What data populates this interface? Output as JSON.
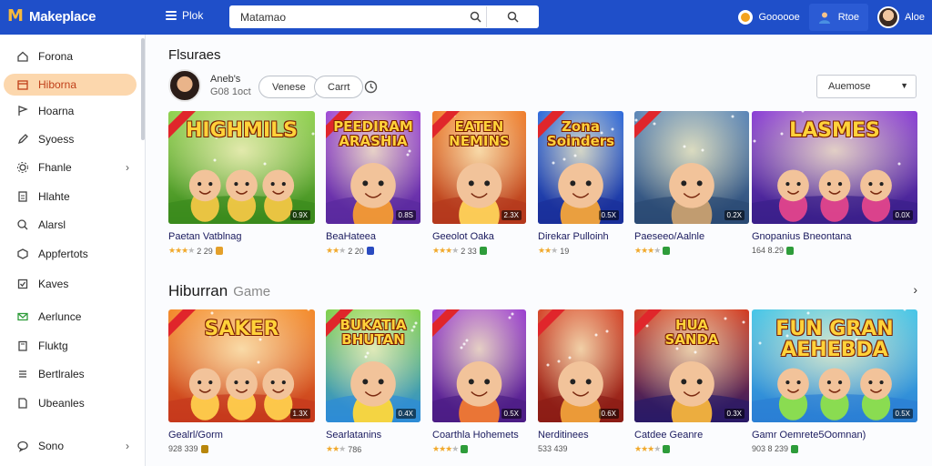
{
  "header": {
    "app_name": "Makeplace",
    "menu_label": "Plok",
    "search_value": "Matamao",
    "coins_label": "Goooooe",
    "account_label": "Rtoe",
    "user_label": "Aloe"
  },
  "sidebar": {
    "items": [
      {
        "label": "Forona",
        "icon": "home-icon",
        "active": false,
        "chevron": false
      },
      {
        "label": "Hiborna",
        "icon": "calendar-icon",
        "active": true,
        "chevron": false
      },
      {
        "label": "Hoarna",
        "icon": "flag-icon",
        "active": false,
        "chevron": false
      },
      {
        "label": "Syoess",
        "icon": "edit-icon",
        "active": false,
        "chevron": false
      },
      {
        "label": "Fhanle",
        "icon": "gear-icon",
        "active": false,
        "chevron": true
      },
      {
        "label": "Hlahte",
        "icon": "document-icon",
        "active": false,
        "chevron": false
      },
      {
        "label": "Alarsl",
        "icon": "search-icon",
        "active": false,
        "chevron": false
      },
      {
        "label": "Appfertots",
        "icon": "cube-icon",
        "active": false,
        "chevron": false
      },
      {
        "label": "Kaves",
        "icon": "checklist-icon",
        "active": false,
        "chevron": false
      },
      {
        "label": "Aerlunce",
        "icon": "mail-icon",
        "active": false,
        "chevron": false
      },
      {
        "label": "Fluktg",
        "icon": "clipboard-icon",
        "active": false,
        "chevron": false
      },
      {
        "label": "Bertlrales",
        "icon": "list-icon",
        "active": false,
        "chevron": false
      },
      {
        "label": "Ubeanles",
        "icon": "page-icon",
        "active": false,
        "chevron": false
      },
      {
        "label": "Sono",
        "icon": "chat-icon",
        "active": false,
        "chevron": true
      }
    ]
  },
  "section1": {
    "title": "Flsuraes",
    "author_name": "Aneb's",
    "author_sub": "G08 1oct",
    "filter1": "Venese",
    "filter2": "Carrt",
    "sort_value": "Auemose"
  },
  "row1": [
    {
      "thumb_text": "HIGHMILS",
      "badge": "0.9X",
      "title": "Paetan Vatblnag",
      "meta": "2 29",
      "stars": 3,
      "icon_color": "#e4a02a",
      "theme": "green"
    },
    {
      "thumb_text": "PEEDIRAM\nARASHIA",
      "badge": "0.8S",
      "title": "BeaHateea",
      "meta": "2 20",
      "stars": 2,
      "icon_color": "#2a4bc0",
      "theme": "purple"
    },
    {
      "thumb_text": "EATEN\nNEMINS",
      "badge": "2.3X",
      "title": "Geeolot Oaka",
      "meta": "2 33",
      "stars": 3,
      "icon_color": "#2e9c3a",
      "theme": "orange"
    },
    {
      "thumb_text": "Zona\nSoinders",
      "badge": "0.5X",
      "title": "Direkar Pulloinh",
      "meta": "19",
      "stars": 2,
      "icon_color": "",
      "theme": "blue"
    },
    {
      "thumb_text": "",
      "badge": "0.2X",
      "title": "Paeseeo/Aalnle",
      "meta": "",
      "stars": 3,
      "icon_color": "#2e9c3a",
      "theme": "steel"
    },
    {
      "thumb_text": "LASMES",
      "badge": "0.0X",
      "title": "Gnopanius Bneontana",
      "meta": "164 8.29",
      "stars": 0,
      "icon_color": "#2e9c3a",
      "theme": "violet"
    }
  ],
  "section2": {
    "title": "Hiburran",
    "subtitle": "Game"
  },
  "row2": [
    {
      "thumb_text": "SAKER",
      "badge": "1.3X",
      "title": "Gealrl/Gorm",
      "meta": "928 339",
      "stars": 0,
      "icon_color": "#b8860b",
      "theme": "bear"
    },
    {
      "thumb_text": "BUKATIA\nBHUTAN",
      "badge": "0.4X",
      "title": "Searlatanins",
      "meta": "786",
      "stars": 2,
      "icon_color": "",
      "theme": "yellow"
    },
    {
      "thumb_text": "",
      "badge": "0.5X",
      "title": "Coarthla Hohemets",
      "meta": "",
      "stars": 3,
      "icon_color": "#2e9c3a",
      "theme": "purple2"
    },
    {
      "thumb_text": "",
      "badge": "0.6X",
      "title": "Nerditinees",
      "meta": "533 439",
      "stars": 0,
      "icon_color": "",
      "theme": "red"
    },
    {
      "thumb_text": "HUA\nSANDA",
      "badge": "0.3X",
      "title": "Catdee Geanre",
      "meta": "",
      "stars": 3,
      "icon_color": "#2e9c3a",
      "theme": "lava"
    },
    {
      "thumb_text": "FUN GRAN\nAEHEBDA",
      "badge": "0.5X",
      "title": "Gamr Oemrete5Oomnan)",
      "meta": "903 8 239",
      "stars": 0,
      "icon_color": "#2e9c3a",
      "theme": "sky"
    }
  ],
  "theme_colors": {
    "header": "#1f4fc9",
    "active_nav": "#fcd7ad",
    "active_text": "#c0401a",
    "star": "#f1a92c"
  }
}
